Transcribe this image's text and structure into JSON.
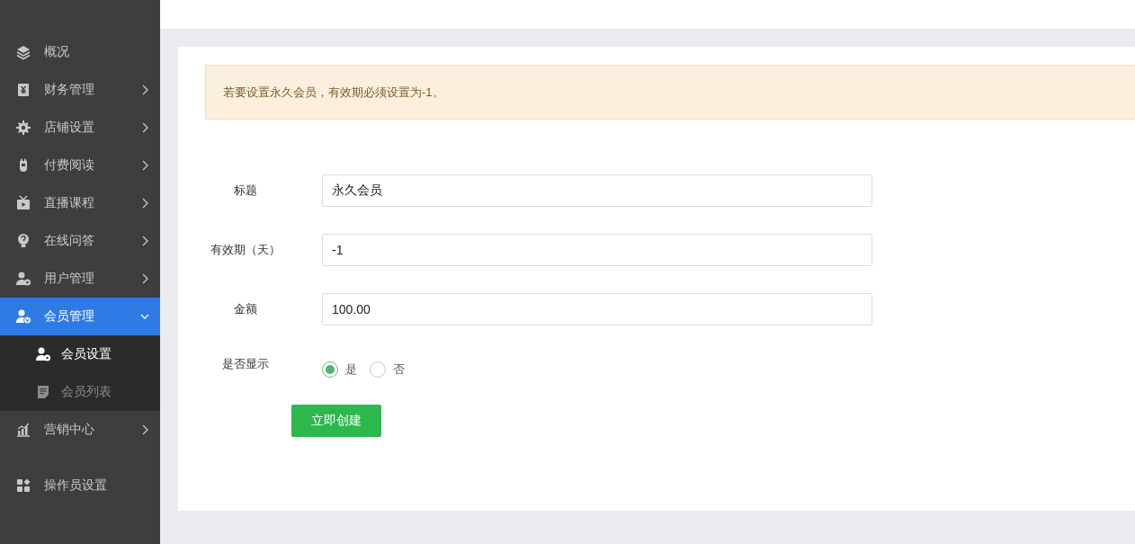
{
  "sidebar": {
    "sections": [
      [
        {
          "label": "概况",
          "selected": false
        },
        {
          "label": "财务管理",
          "expanded": false,
          "selected": false
        },
        {
          "label": "店铺设置",
          "expanded": false,
          "selected": false
        },
        {
          "label": "付费阅读",
          "expanded": false,
          "selected": false
        },
        {
          "label": "直播课程",
          "expanded": false,
          "selected": false
        },
        {
          "label": "在线问答",
          "expanded": false,
          "selected": false
        },
        {
          "label": "用户管理",
          "expanded": false,
          "selected": false
        },
        {
          "label": "会员管理",
          "expanded": true,
          "selected": true,
          "children": [
            {
              "label": "会员设置",
              "selected": true
            },
            {
              "label": "会员列表",
              "selected": false
            }
          ]
        },
        {
          "label": "营销中心",
          "expanded": false,
          "selected": false
        }
      ],
      [
        {
          "label": "操作员设置",
          "selected": false
        }
      ]
    ]
  },
  "alert": {
    "text": "若要设置永久会员，有效期必须设置为-1。"
  },
  "form": {
    "fields": [
      {
        "kind": "text",
        "label": "标题",
        "value": "永久会员"
      },
      {
        "kind": "text",
        "label": "有效期（天）",
        "value": "-1"
      },
      {
        "kind": "text",
        "label": "金额",
        "value": "100.00"
      },
      {
        "kind": "radio",
        "label": "是否显示",
        "options": [
          {
            "label": "是",
            "selected": true
          },
          {
            "label": "否",
            "selected": false
          }
        ]
      }
    ],
    "submit": "立即创建"
  }
}
